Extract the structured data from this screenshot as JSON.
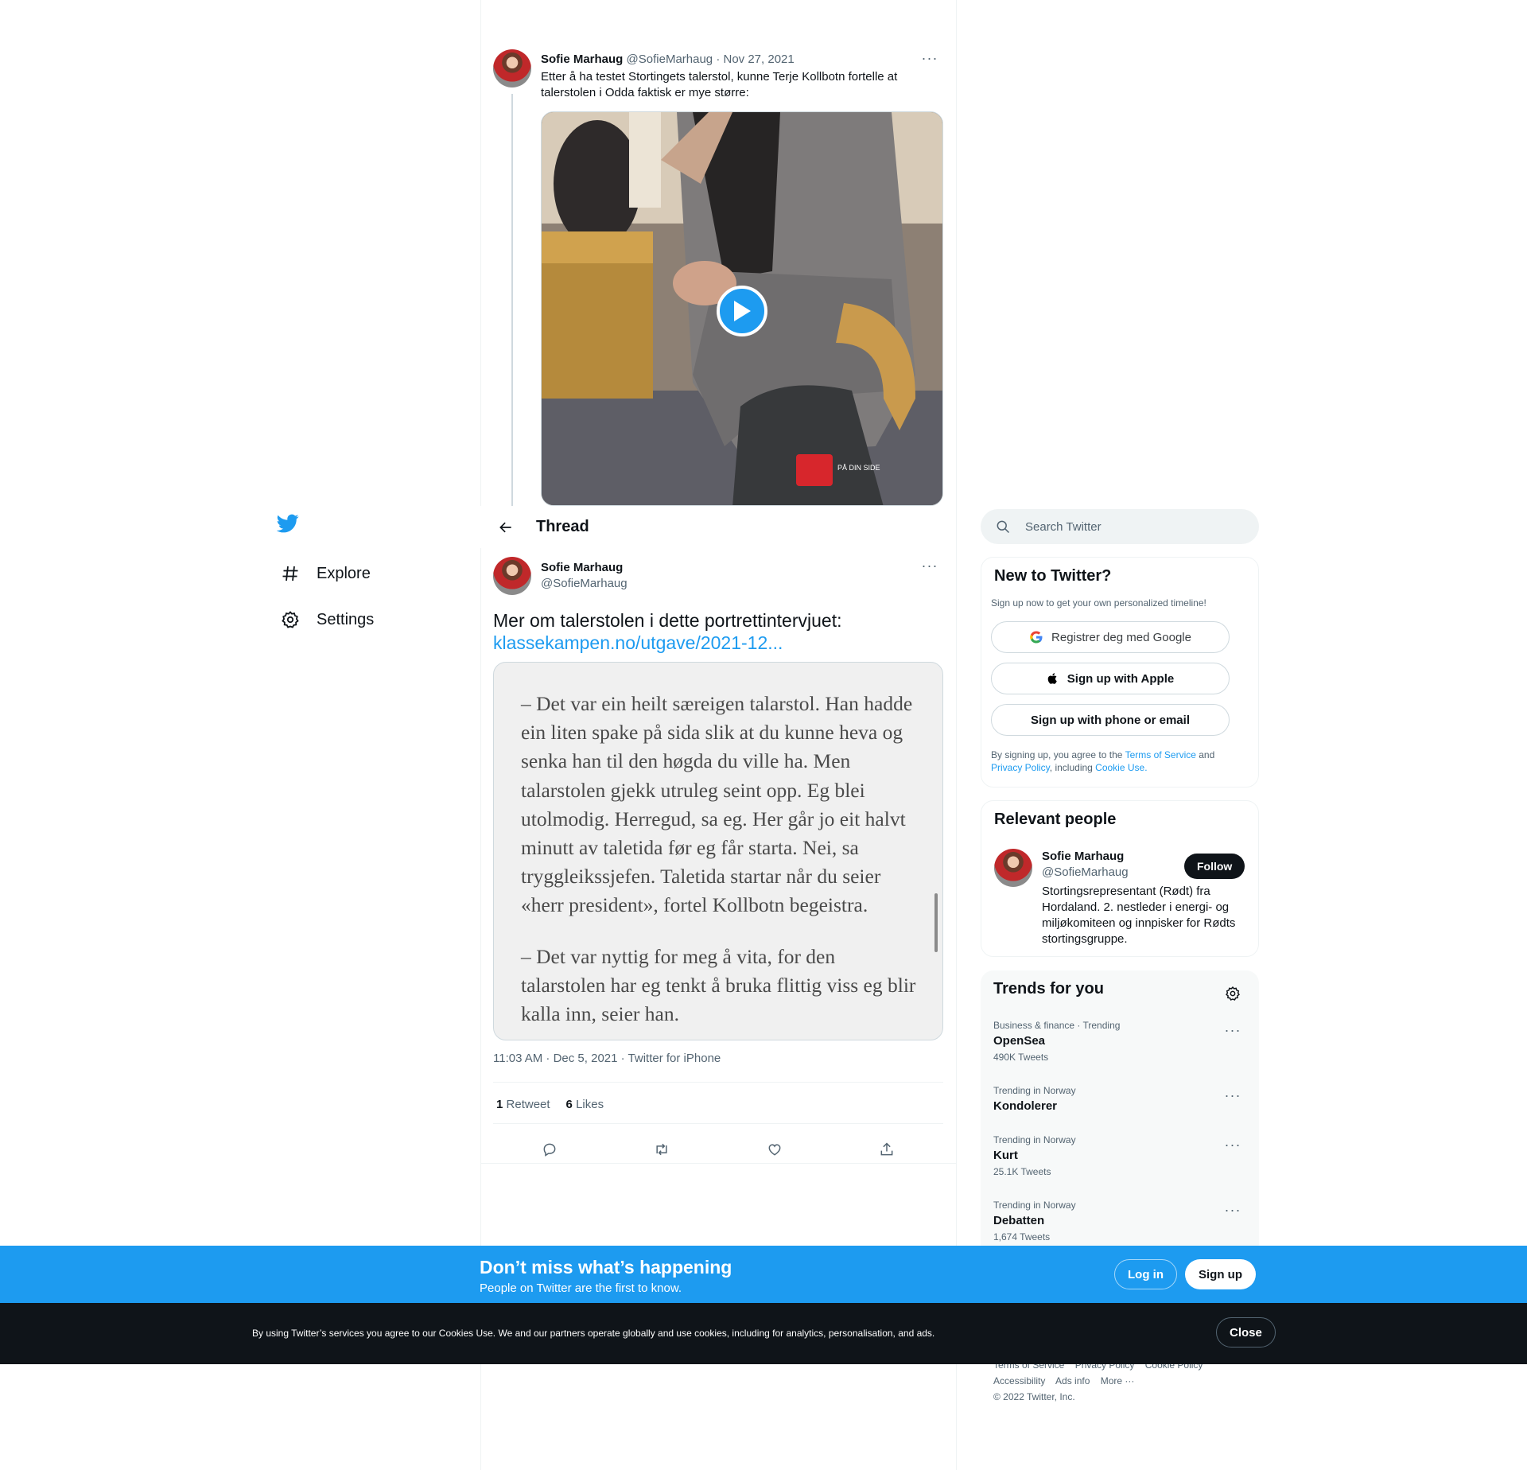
{
  "nav": {
    "items": [
      {
        "label": "Explore",
        "icon": "hashtag-icon"
      },
      {
        "label": "Settings",
        "icon": "gear-icon"
      }
    ]
  },
  "thread": {
    "header_title": "Thread",
    "parent": {
      "name": "Sofie Marhaug",
      "handle": "@SofieMarhaug",
      "date": "Nov 27, 2021",
      "text": "Etter å ha testet Stortingets talerstol, kunne Terje Kollbotn fortelle at talerstolen i Odda faktisk er mye større:",
      "bag_logo_text": "PÅ DIN SIDE"
    },
    "focus": {
      "name": "Sofie Marhaug",
      "handle": "@SofieMarhaug",
      "text": "Mer om talerstolen i dette portrettintervjuet:",
      "link": "klassekampen.no/utgave/2021-12...",
      "quote_p1": "– Det var ein heilt særeigen talarstol. Han hadde ein liten spake på sida slik at du kunne heva og senka han til den høgda du ville ha. Men talarstolen gjekk utruleg seint opp. Eg blei utolmodig. Herregud, sa eg. Her går jo eit halvt minutt av taletida før eg får starta. Nei, sa tryggleikssjefen. Taletida startar når du seier «herr president», fortel Kollbotn begeistra.",
      "quote_p2": "– Det var nyttig for meg å vita, for den talarstolen har eg tenkt å bruka flittig viss eg blir kalla inn, seier han.",
      "meta": "11:03 AM · Dec 5, 2021 · Twitter for iPhone",
      "retweets_count": "1",
      "retweets_label": "Retweet",
      "likes_count": "6",
      "likes_label": "Likes"
    }
  },
  "sidebar": {
    "search_placeholder": "Search Twitter",
    "new_to_twitter": {
      "title": "New to Twitter?",
      "subtitle": "Sign up now to get your own personalized timeline!",
      "google": "Registrer deg med Google",
      "apple": "Sign up with Apple",
      "phone": "Sign up with phone or email",
      "legal_1": "By signing up, you agree to the ",
      "terms": "Terms of Service",
      "legal_2": " and ",
      "privacy": "Privacy Policy",
      "legal_3": ", including ",
      "cookie": "Cookie Use."
    },
    "relevant": {
      "title": "Relevant people",
      "name": "Sofie Marhaug",
      "handle": "@SofieMarhaug",
      "follow": "Follow",
      "bio": "Stortingsrepresentant (Rødt) fra Hordaland. 2. nestleder i energi- og miljøkomiteen og innpisker for Rødts stortingsgruppe."
    },
    "trends": {
      "title": "Trends for you",
      "items": [
        {
          "category": "Business & finance · Trending",
          "name": "OpenSea",
          "count": "490K Tweets"
        },
        {
          "category": "Trending in Norway",
          "name": "Kondolerer",
          "count": ""
        },
        {
          "category": "Trending in Norway",
          "name": "Kurt",
          "count": "25.1K Tweets"
        },
        {
          "category": "Trending in Norway",
          "name": "Debatten",
          "count": "1,674 Tweets"
        }
      ]
    },
    "footer": {
      "terms": "Terms of Service",
      "privacy": "Privacy Policy",
      "cookie": "Cookie Policy",
      "accessibility": "Accessibility",
      "ads": "Ads info",
      "more": "More ···",
      "copyright": "© 2022 Twitter, Inc."
    }
  },
  "banner": {
    "title": "Don’t miss what’s happening",
    "subtitle": "People on Twitter are the first to know.",
    "login": "Log in",
    "signup": "Sign up"
  },
  "cookie_bar": {
    "text": "By using Twitter’s services you agree to our Cookies Use. We and our partners operate globally and use cookies, including for analytics, personalisation, and ads.",
    "close": "Close"
  },
  "colors": {
    "accent": "#1d9bf0",
    "text": "#0f1419",
    "muted": "#536471",
    "cookie_bg": "#0f1419"
  }
}
